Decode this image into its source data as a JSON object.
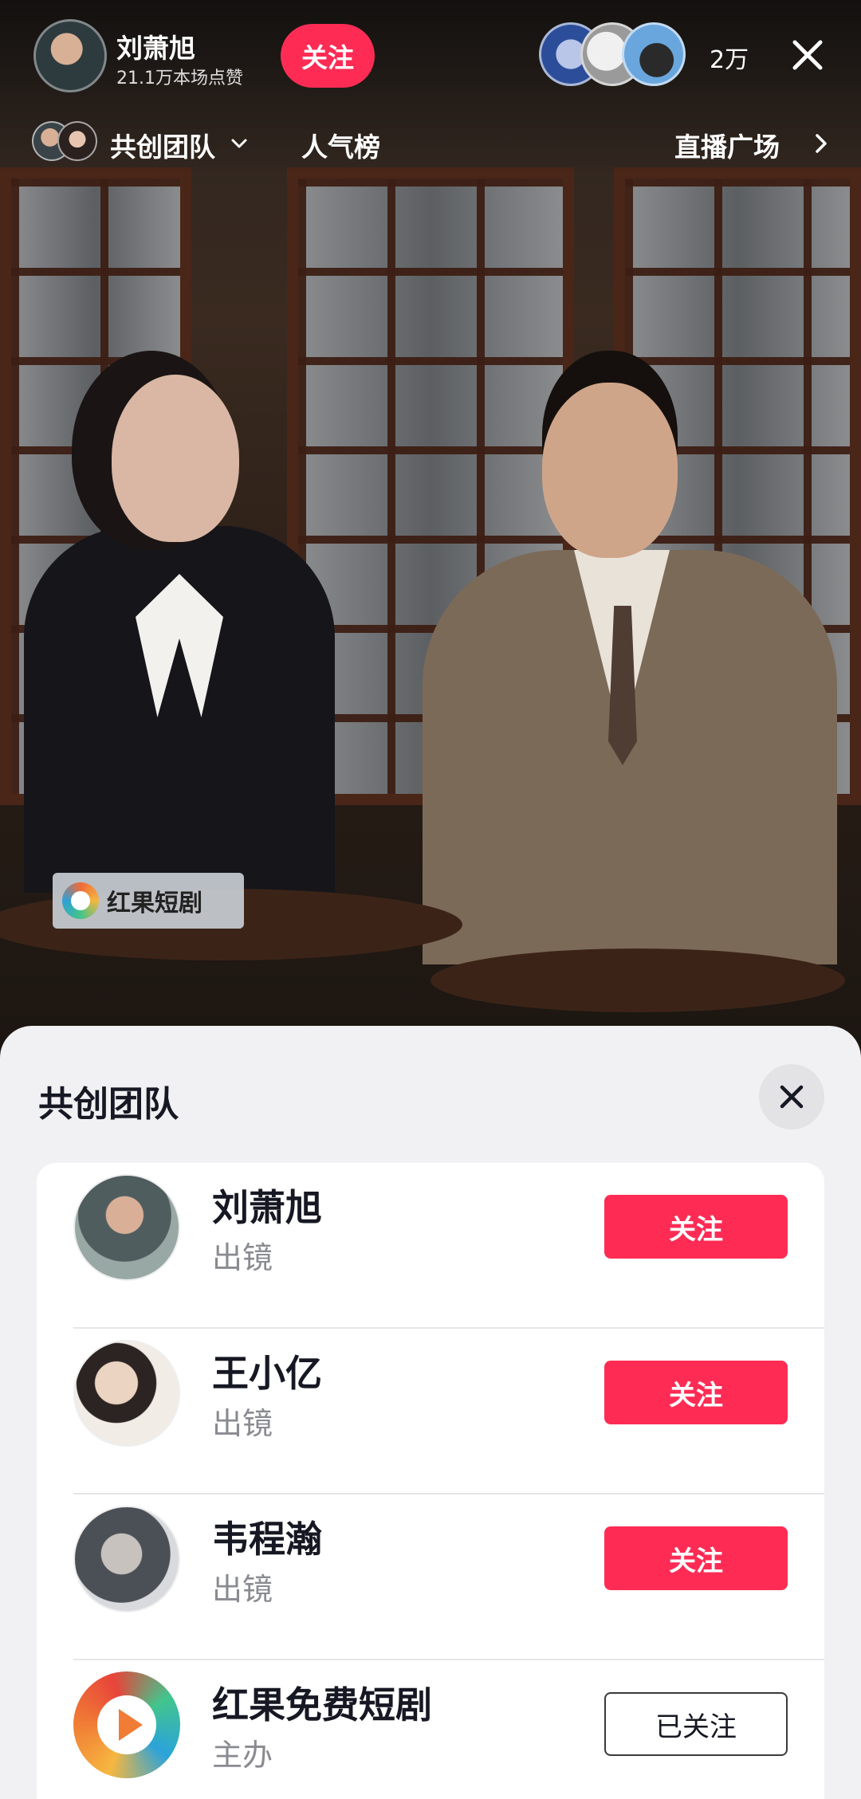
{
  "host": {
    "name": "刘萧旭",
    "likes": "21.1万本场点赞",
    "follow_label": "关注"
  },
  "viewers": {
    "count": "2万"
  },
  "nav": {
    "team_label": "共创团队",
    "rank_label": "人气榜",
    "plaza_label": "直播广场"
  },
  "stream": {
    "plate_text": "红果短剧"
  },
  "sheet": {
    "title": "共创团队",
    "members": [
      {
        "name": "刘萧旭",
        "role": "出镜",
        "button": "关注",
        "followed": false
      },
      {
        "name": "王小亿",
        "role": "出镜",
        "button": "关注",
        "followed": false
      },
      {
        "name": "韦程瀚",
        "role": "出镜",
        "button": "关注",
        "followed": false
      },
      {
        "name": "红果免费短剧",
        "role": "主办",
        "button": "已关注",
        "followed": true
      }
    ]
  },
  "colors": {
    "accent": "#fe2c55",
    "sheet_bg": "#f1f1f3"
  },
  "icons": [
    "close-icon",
    "chevron-down-icon",
    "chevron-right-icon",
    "play-logo-icon"
  ]
}
